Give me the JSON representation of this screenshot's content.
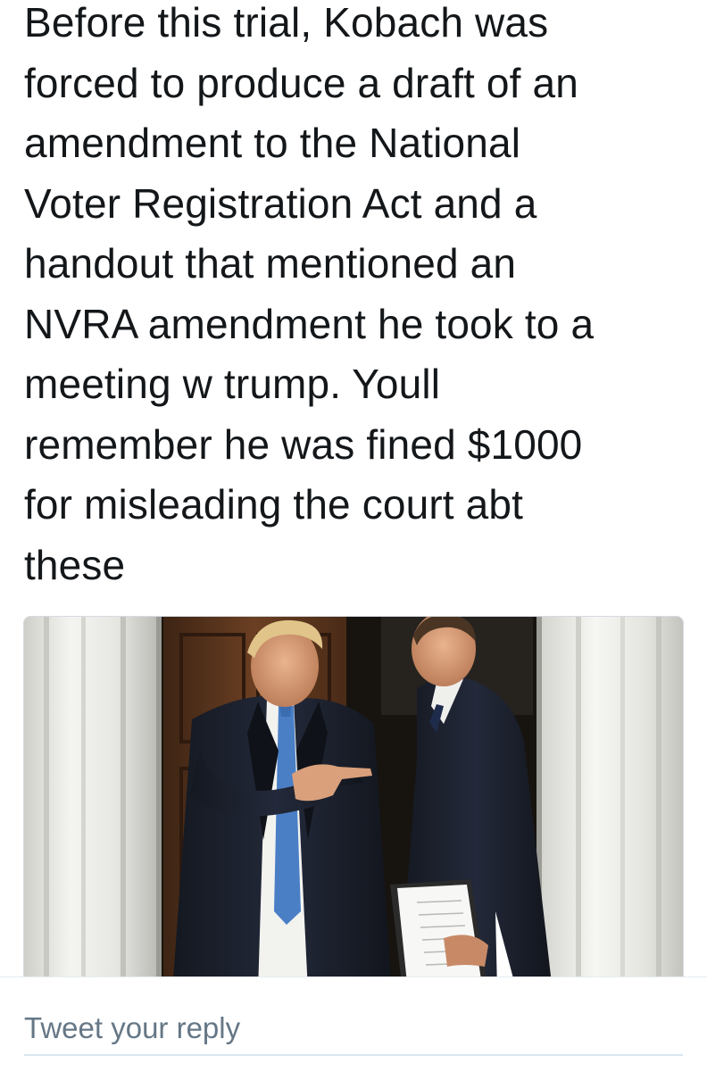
{
  "tweet": {
    "text": "Before this trial, Kobach was\nforced to produce a draft of an\namendment to the National\nVoter Registration Act and a\nhandout that mentioned an\nNVRA amendment he took to a\nmeeting w trump. Youll\nremember he was fined $1000\nfor misleading the court abt\nthese"
  },
  "media": {
    "kind": "photo",
    "subject": "two-men-in-suits-at-doorway"
  },
  "reply": {
    "placeholder": "Tweet your reply"
  },
  "colors": {
    "text": "#14171a",
    "placeholder": "#657786",
    "divider": "#e6ecf0"
  }
}
